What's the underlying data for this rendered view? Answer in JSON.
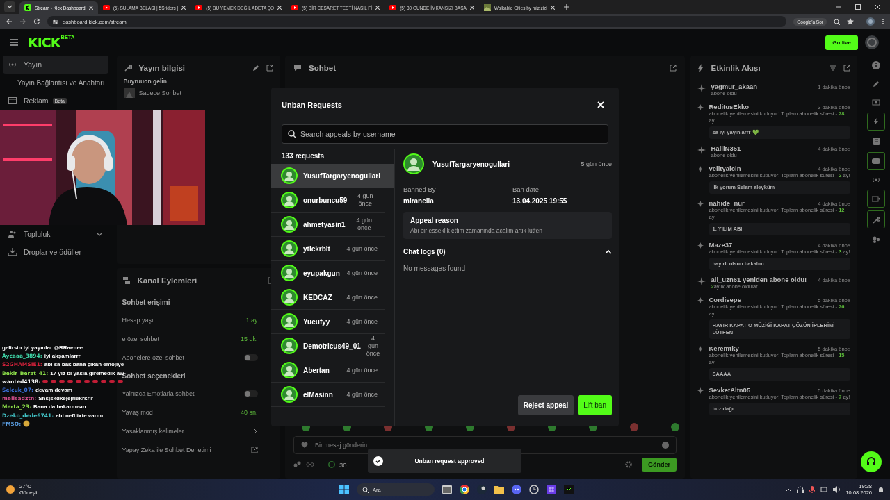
{
  "browser": {
    "tabs": [
      {
        "title": "Stream - Kick Dashboard",
        "selected": true,
        "kind": "kick"
      },
      {
        "title": "(5) SULAMA BELASI | 5Sriders |",
        "selected": false,
        "kind": "youtube"
      },
      {
        "title": "(5) BU YEMEK DEĞİL ADETA ŞÖ",
        "selected": false,
        "kind": "youtube"
      },
      {
        "title": "(5) BİR CESARET TESTİ NASIL Fİ",
        "selected": false,
        "kind": "youtube"
      },
      {
        "title": "(5) 30 GÜNDE İMKANSIZI BAŞA",
        "selected": false,
        "kind": "youtube"
      },
      {
        "title": "Walkable Cities by mizizizi",
        "selected": false,
        "kind": "map"
      }
    ],
    "url": "dashboard.kick.com/stream",
    "assistant": "Google'a Sor"
  },
  "header": {
    "logo": "KICK",
    "logo_badge": "BETA",
    "go_live": "Go live"
  },
  "sidebar": {
    "items": [
      {
        "label": "Yayın",
        "selected": true,
        "kind": "broadcast"
      },
      {
        "label": "Yayın Bağlantısı ve Anahtarı",
        "selected": false,
        "kind": "sub"
      },
      {
        "label": "Reklam",
        "badge": "Beta",
        "selected": false,
        "kind": "ads"
      }
    ],
    "lower_items": [
      {
        "label": "Topluluk",
        "selected": false,
        "kind": "community"
      },
      {
        "label": "Droplar ve ödüller",
        "selected": false,
        "kind": "drops"
      }
    ]
  },
  "stream_info": {
    "title": "Yayın bilgisi",
    "stream_title": "Buyruuon gelin",
    "category": "Sadece Sohbet"
  },
  "channel_actions": {
    "title": "Kanal Eylemleri",
    "sections": [
      {
        "title": "Sohbet erişimi",
        "rows": [
          {
            "kind": "value",
            "label": "Hesap yaşı",
            "value": "1 ay"
          },
          {
            "kind": "value",
            "label": "e özel sohbet",
            "value": "15 dk."
          },
          {
            "kind": "toggle",
            "label": "Abonelere özel sohbet",
            "on": false
          }
        ]
      },
      {
        "title": "Sohbet seçenekleri",
        "rows": [
          {
            "kind": "toggle",
            "label": "Yalnızca Emotlarla sohbet",
            "on": false
          },
          {
            "kind": "value",
            "label": "Yavaş mod",
            "value": "40 sn."
          },
          {
            "kind": "link",
            "label": "Yasaklanmış kelimeler"
          },
          {
            "kind": "external",
            "label": "Yapay Zeka ile Sohbet Denetimi"
          }
        ]
      }
    ]
  },
  "chat": {
    "title": "Sohbet",
    "placeholder": "Bir mesaj gönderin",
    "count": "30",
    "send": "Gönder"
  },
  "activity": {
    "title": "Etkinlik Akışı",
    "items": [
      {
        "kind": "sub",
        "name": "yagmur_akaan",
        "time": "1 dakika önce",
        "detail": "abone oldu"
      },
      {
        "kind": "resub",
        "name": "ReditusEkko",
        "time": "3 dakika önce",
        "text": "abonelik yenilemesini kutluyor! Toplam abonelik süresi -",
        "months": "28",
        "unit": "ay!",
        "message": "sa iyi yayınlarrr 💚"
      },
      {
        "kind": "sub",
        "name": "HalilN351",
        "time": "4 dakika önce",
        "detail": "abone oldu"
      },
      {
        "kind": "resub",
        "name": "velityalcin",
        "time": "4 dakika önce",
        "text": "abonelik yenilemesini kutluyor! Toplam abonelik süresi -",
        "months": "2",
        "unit": "ay!",
        "message": "İlk yorum Selam aleyküm"
      },
      {
        "kind": "resub",
        "name": "nahide_nur",
        "time": "4 dakika önce",
        "text": "abonelik yenilemesini kutluyor! Toplam abonelik süresi -",
        "months": "12",
        "unit": "ay!",
        "message": "1. YILIM ABİ"
      },
      {
        "kind": "resub",
        "name": "Maze37",
        "time": "4 dakika önce",
        "text": "abonelik yenilemesini kutluyor! Toplam abonelik süresi -",
        "months": "3",
        "unit": "ay!",
        "message": "hayırlı olsun bakalım"
      },
      {
        "kind": "sub",
        "name": "ali_uzn61 yeniden abone oldu!",
        "time": "4 dakika önce",
        "months": "2",
        "detail": "aylık abone oldular"
      },
      {
        "kind": "resub",
        "name": "Cordiseps",
        "time": "5 dakika önce",
        "text": "abonelik yenilemesini kutluyor! Toplam abonelik süresi -",
        "months": "26",
        "unit": "ay!",
        "message": "HAYIR KAPAT O MÜZİĞİ KAPAT ÇÖZÜN İPLERİMİ LÜTFEN"
      },
      {
        "kind": "resub",
        "name": "Keremtky",
        "time": "5 dakika önce",
        "text": "abonelik yenilemesini kutluyor! Toplam abonelik süresi -",
        "months": "15",
        "unit": "ay!",
        "message": "SAAAA"
      },
      {
        "kind": "resub",
        "name": "SevketAltn05",
        "time": "5 dakika önce",
        "text": "abonelik yenilemesini kutluyor! Toplam abonelik süresi -",
        "months": "7",
        "unit": "ay!",
        "message": "buz dağı"
      }
    ]
  },
  "overlay_chat": [
    {
      "text": "gelirsin iyi yayınlar @RRaenee"
    },
    {
      "user": "Aycaaa_3894:",
      "color": "#3fd6a8",
      "text": "iyi akşamlarrr"
    },
    {
      "user": "S2GHAMSIE1:",
      "color": "#d0213a",
      "text": "abi sa bak bana çıkan emojiye"
    },
    {
      "user": "Bekir_Berat_41:",
      "color": "#8ee04a",
      "text": "17 yiz bi yaşla giremedik aw"
    },
    {
      "user": "wanted4138:",
      "color": "#ffffff",
      "kind": "emotes"
    },
    {
      "user": "Selcuk_07:",
      "color": "#3a6fd8",
      "text": "devam devam"
    },
    {
      "user": "melisadztn:",
      "color": "#d04d8a",
      "text": "Shsjskdkejejrlekrkrlr"
    },
    {
      "user": "Merta_23:",
      "color": "#8ee04a",
      "text": "Bana da bakarmısın"
    },
    {
      "user": "Dzeko_dede6741:",
      "color": "#43c6c9",
      "text": "abi neftlixte varmı"
    },
    {
      "user": "FM5Q:",
      "color": "#5a9de0",
      "kind": "emote"
    }
  ],
  "modal": {
    "title": "Unban Requests",
    "search_placeholder": "Search appeals by username",
    "count": "133 requests",
    "requests": [
      {
        "name": "YusufTargaryenogullari",
        "selected": true
      },
      {
        "name": "onurbuncu59",
        "time": "4 gün önce",
        "selected": false
      },
      {
        "name": "ahmetyasin1",
        "time": "4 gün önce",
        "selected": false
      },
      {
        "name": "ytickrblt",
        "time": "4 gün önce",
        "selected": false
      },
      {
        "name": "eyupakgun",
        "time": "4 gün önce",
        "selected": false
      },
      {
        "name": "KEDCAZ",
        "time": "4 gün önce",
        "selected": false
      },
      {
        "name": "Yueufyy",
        "time": "4 gün önce",
        "selected": false
      },
      {
        "name": "Demotricus49_01",
        "time": "4 gün önce",
        "selected": false
      },
      {
        "name": "Abertan",
        "time": "4 gün önce",
        "selected": false
      },
      {
        "name": "elMasinn",
        "time": "4 gün önce",
        "selected": false
      }
    ],
    "detail": {
      "name": "YusufTargaryenogullari",
      "time": "5 gün önce",
      "banned_by_label": "Banned By",
      "banned_by": "miranelia",
      "ban_date_label": "Ban date",
      "ban_date": "13.04.2025 19:55",
      "reason_title": "Appeal reason",
      "reason": "Abi bir esseklik ettim zamaninda acalim artik lutfen",
      "chat_logs": "Chat logs (0)",
      "expanded": true,
      "empty": "No messages found"
    },
    "reject": "Reject appeal",
    "lift": "Lift ban"
  },
  "toast": "Unban request approved",
  "taskbar": {
    "temperature": "27°C",
    "weather": "Güneşli",
    "search": "Ara",
    "time": "19:38",
    "date": "10.08.2026"
  }
}
